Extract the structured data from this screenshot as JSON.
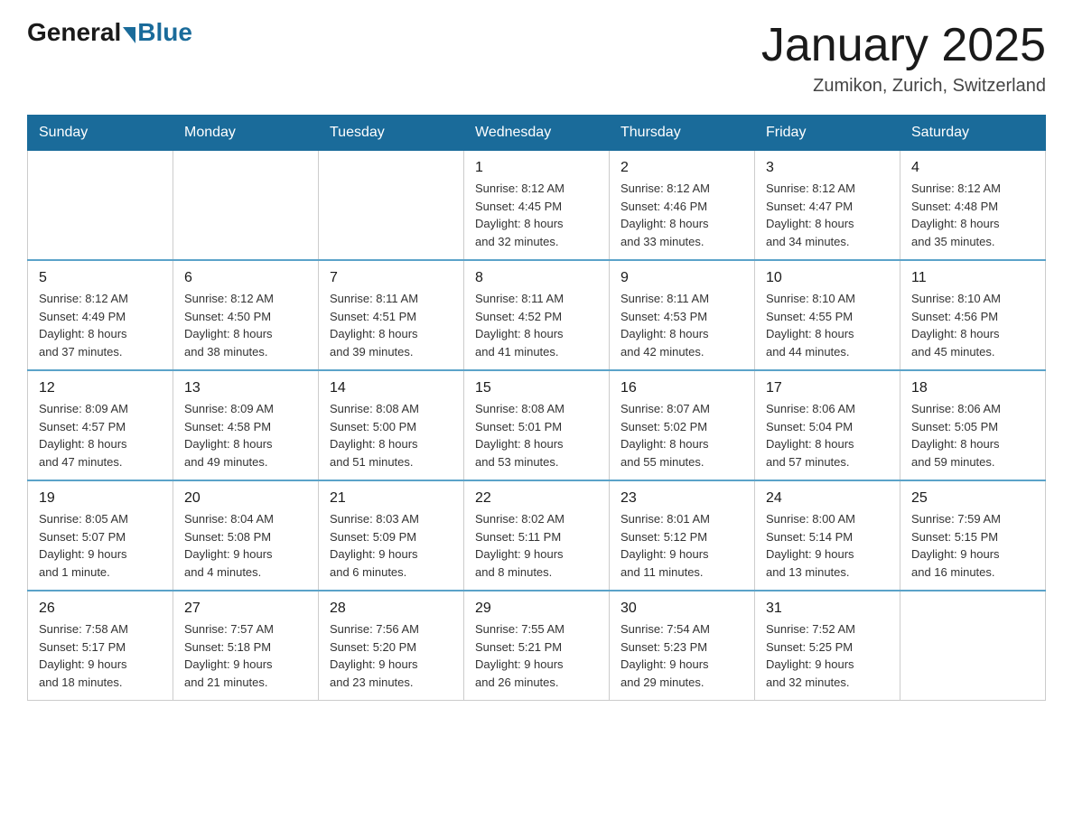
{
  "header": {
    "logo_general": "General",
    "logo_blue": "Blue",
    "month_title": "January 2025",
    "location": "Zumikon, Zurich, Switzerland"
  },
  "calendar": {
    "days_of_week": [
      "Sunday",
      "Monday",
      "Tuesday",
      "Wednesday",
      "Thursday",
      "Friday",
      "Saturday"
    ],
    "weeks": [
      [
        {
          "day": "",
          "info": ""
        },
        {
          "day": "",
          "info": ""
        },
        {
          "day": "",
          "info": ""
        },
        {
          "day": "1",
          "info": "Sunrise: 8:12 AM\nSunset: 4:45 PM\nDaylight: 8 hours\nand 32 minutes."
        },
        {
          "day": "2",
          "info": "Sunrise: 8:12 AM\nSunset: 4:46 PM\nDaylight: 8 hours\nand 33 minutes."
        },
        {
          "day": "3",
          "info": "Sunrise: 8:12 AM\nSunset: 4:47 PM\nDaylight: 8 hours\nand 34 minutes."
        },
        {
          "day": "4",
          "info": "Sunrise: 8:12 AM\nSunset: 4:48 PM\nDaylight: 8 hours\nand 35 minutes."
        }
      ],
      [
        {
          "day": "5",
          "info": "Sunrise: 8:12 AM\nSunset: 4:49 PM\nDaylight: 8 hours\nand 37 minutes."
        },
        {
          "day": "6",
          "info": "Sunrise: 8:12 AM\nSunset: 4:50 PM\nDaylight: 8 hours\nand 38 minutes."
        },
        {
          "day": "7",
          "info": "Sunrise: 8:11 AM\nSunset: 4:51 PM\nDaylight: 8 hours\nand 39 minutes."
        },
        {
          "day": "8",
          "info": "Sunrise: 8:11 AM\nSunset: 4:52 PM\nDaylight: 8 hours\nand 41 minutes."
        },
        {
          "day": "9",
          "info": "Sunrise: 8:11 AM\nSunset: 4:53 PM\nDaylight: 8 hours\nand 42 minutes."
        },
        {
          "day": "10",
          "info": "Sunrise: 8:10 AM\nSunset: 4:55 PM\nDaylight: 8 hours\nand 44 minutes."
        },
        {
          "day": "11",
          "info": "Sunrise: 8:10 AM\nSunset: 4:56 PM\nDaylight: 8 hours\nand 45 minutes."
        }
      ],
      [
        {
          "day": "12",
          "info": "Sunrise: 8:09 AM\nSunset: 4:57 PM\nDaylight: 8 hours\nand 47 minutes."
        },
        {
          "day": "13",
          "info": "Sunrise: 8:09 AM\nSunset: 4:58 PM\nDaylight: 8 hours\nand 49 minutes."
        },
        {
          "day": "14",
          "info": "Sunrise: 8:08 AM\nSunset: 5:00 PM\nDaylight: 8 hours\nand 51 minutes."
        },
        {
          "day": "15",
          "info": "Sunrise: 8:08 AM\nSunset: 5:01 PM\nDaylight: 8 hours\nand 53 minutes."
        },
        {
          "day": "16",
          "info": "Sunrise: 8:07 AM\nSunset: 5:02 PM\nDaylight: 8 hours\nand 55 minutes."
        },
        {
          "day": "17",
          "info": "Sunrise: 8:06 AM\nSunset: 5:04 PM\nDaylight: 8 hours\nand 57 minutes."
        },
        {
          "day": "18",
          "info": "Sunrise: 8:06 AM\nSunset: 5:05 PM\nDaylight: 8 hours\nand 59 minutes."
        }
      ],
      [
        {
          "day": "19",
          "info": "Sunrise: 8:05 AM\nSunset: 5:07 PM\nDaylight: 9 hours\nand 1 minute."
        },
        {
          "day": "20",
          "info": "Sunrise: 8:04 AM\nSunset: 5:08 PM\nDaylight: 9 hours\nand 4 minutes."
        },
        {
          "day": "21",
          "info": "Sunrise: 8:03 AM\nSunset: 5:09 PM\nDaylight: 9 hours\nand 6 minutes."
        },
        {
          "day": "22",
          "info": "Sunrise: 8:02 AM\nSunset: 5:11 PM\nDaylight: 9 hours\nand 8 minutes."
        },
        {
          "day": "23",
          "info": "Sunrise: 8:01 AM\nSunset: 5:12 PM\nDaylight: 9 hours\nand 11 minutes."
        },
        {
          "day": "24",
          "info": "Sunrise: 8:00 AM\nSunset: 5:14 PM\nDaylight: 9 hours\nand 13 minutes."
        },
        {
          "day": "25",
          "info": "Sunrise: 7:59 AM\nSunset: 5:15 PM\nDaylight: 9 hours\nand 16 minutes."
        }
      ],
      [
        {
          "day": "26",
          "info": "Sunrise: 7:58 AM\nSunset: 5:17 PM\nDaylight: 9 hours\nand 18 minutes."
        },
        {
          "day": "27",
          "info": "Sunrise: 7:57 AM\nSunset: 5:18 PM\nDaylight: 9 hours\nand 21 minutes."
        },
        {
          "day": "28",
          "info": "Sunrise: 7:56 AM\nSunset: 5:20 PM\nDaylight: 9 hours\nand 23 minutes."
        },
        {
          "day": "29",
          "info": "Sunrise: 7:55 AM\nSunset: 5:21 PM\nDaylight: 9 hours\nand 26 minutes."
        },
        {
          "day": "30",
          "info": "Sunrise: 7:54 AM\nSunset: 5:23 PM\nDaylight: 9 hours\nand 29 minutes."
        },
        {
          "day": "31",
          "info": "Sunrise: 7:52 AM\nSunset: 5:25 PM\nDaylight: 9 hours\nand 32 minutes."
        },
        {
          "day": "",
          "info": ""
        }
      ]
    ]
  }
}
